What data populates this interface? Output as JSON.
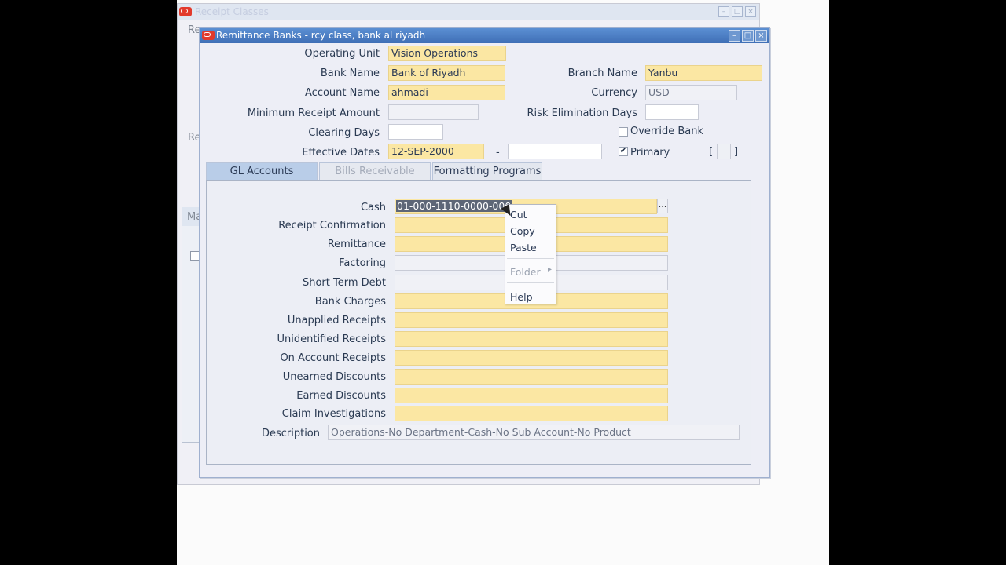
{
  "background_window": {
    "title": "Receipt Classes",
    "frag1": "Re",
    "frag2": "Re",
    "frag3": "Ma"
  },
  "window": {
    "title": "Remittance Banks - rcy class, bank al riyadh"
  },
  "header": {
    "operating_unit_label": "Operating Unit",
    "operating_unit_value": "Vision Operations",
    "bank_name_label": "Bank Name",
    "bank_name_value": "Bank of Riyadh",
    "branch_name_label": "Branch Name",
    "branch_name_value": "Yanbu",
    "account_name_label": "Account Name",
    "account_name_value": "ahmadi",
    "currency_label": "Currency",
    "currency_value": "USD",
    "min_receipt_label": "Minimum Receipt Amount",
    "min_receipt_value": "",
    "risk_days_label": "Risk Elimination Days",
    "risk_days_value": "",
    "clearing_days_label": "Clearing Days",
    "clearing_days_value": "",
    "override_bank_label": "Override Bank",
    "effective_dates_label": "Effective Dates",
    "effective_from": "12-SEP-2000",
    "date_separator": "-",
    "effective_to": "",
    "primary_label": "Primary",
    "bracket_open": "[",
    "bracket_close": "]"
  },
  "tabs": [
    {
      "label": "GL Accounts"
    },
    {
      "label": "Bills Receivable"
    },
    {
      "label": "Formatting Programs"
    }
  ],
  "gl_accounts": {
    "cash_label": "Cash",
    "cash_value": "01-000-1110-0000-000",
    "rows": [
      {
        "label": "Receipt Confirmation"
      },
      {
        "label": "Remittance"
      },
      {
        "label": "Factoring"
      },
      {
        "label": "Short Term Debt"
      },
      {
        "label": "Bank Charges"
      },
      {
        "label": "Unapplied Receipts"
      },
      {
        "label": "Unidentified Receipts"
      },
      {
        "label": "On Account Receipts"
      },
      {
        "label": "Unearned Discounts"
      },
      {
        "label": "Earned Discounts"
      },
      {
        "label": "Claim Investigations"
      }
    ],
    "description_label": "Description",
    "description_value": "Operations-No Department-Cash-No Sub Account-No Product",
    "lov_label": "..."
  },
  "context_menu": {
    "items": [
      {
        "label": "Cut"
      },
      {
        "label": "Copy"
      },
      {
        "label": "Paste"
      },
      {
        "label": "Folder"
      },
      {
        "label": "Help"
      }
    ],
    "submenu_arrow": "▸"
  },
  "icons": {
    "oracle_logo": "oracle-logo-icon",
    "minimize": "minimize-icon",
    "maximize": "maximize-icon",
    "close": "close-icon",
    "check": "✔"
  },
  "colors": {
    "required_field": "#fbe7a3",
    "title_bar": "#4a7ec5",
    "active_tab": "#b9cde8"
  }
}
